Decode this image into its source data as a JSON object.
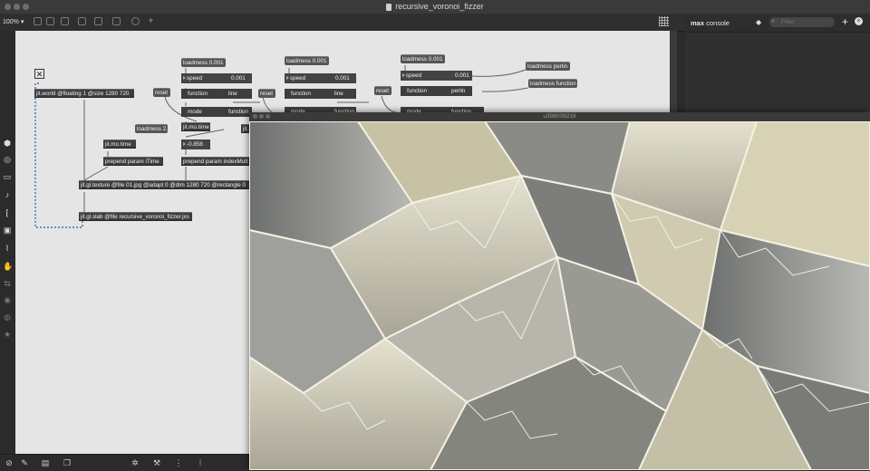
{
  "window": {
    "title": "recursive_voronoi_fizzer"
  },
  "toolbar": {
    "zoom": "100%",
    "zoom_arrow": "▾"
  },
  "patch": {
    "close_glyph": "✕",
    "jit_world": "jit.world @floating 1 @size 1280 720",
    "loadmess_a": "loadmess 0.001",
    "loadmess_b": "loadmess 0.001",
    "loadmess_c": "loadmess 0.001",
    "loadmess_2": "loadmess 2.",
    "loadmess_perlin": "loadmess perlin",
    "loadmess_function": "loadmess function",
    "speed_a": {
      "label": "speed",
      "value": "0.001"
    },
    "speed_b": {
      "label": "speed",
      "value": "0.001"
    },
    "speed_c": {
      "label": "speed",
      "value": "0.001"
    },
    "function_a": {
      "label": "function",
      "value": "line"
    },
    "function_b": {
      "label": "function",
      "value": "line"
    },
    "function_c": {
      "label": "function",
      "value": "perlin"
    },
    "mode_a": {
      "label": "mode",
      "value": "function"
    },
    "mode_b": {
      "label": "mode",
      "value": "function"
    },
    "mode_c": {
      "label": "mode",
      "value": "function"
    },
    "reset_a": "reset",
    "reset_b": "reset",
    "reset_c": "reset",
    "mo_time_a": "jit.mo.time",
    "mo_time_b": "jit.mo.time",
    "mo_time_c": "jit.",
    "number_value": "-0.858",
    "prepend_itime": "prepend param iTime",
    "prepend_indexmult": "prepend param indexMult",
    "gl_texture": "jit.gl.texture @file 01.jpg @adapt 0 @dim 1280 720 @rectangle 0",
    "gl_slab": "jit.gl.slab @file recursive_voronoi_fizzer.jxs"
  },
  "console": {
    "title_bold": "max",
    "title_rest": "console",
    "filter_placeholder": "Filter",
    "add": "+"
  },
  "render_window": {
    "title": "u398009216"
  },
  "colors": {
    "canvas": "#e5e5e5",
    "object": "#3d3d3d",
    "patch_cord": "#5a6470",
    "selection": "#3d6fb0"
  }
}
